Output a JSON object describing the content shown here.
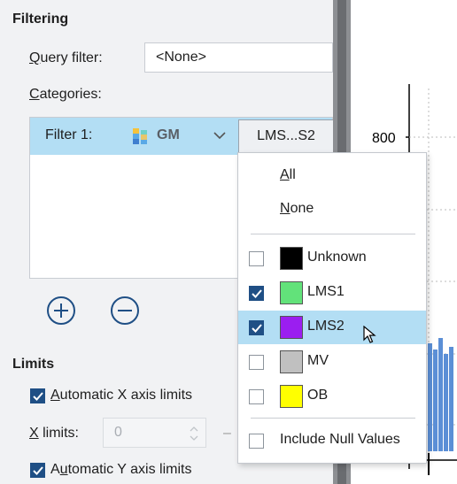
{
  "filtering": {
    "title": "Filtering",
    "query_filter_label": "Query filter:",
    "query_filter_value": "<None>",
    "categories_label": "Categories:",
    "filter_row": {
      "label": "Filter 1:",
      "attribute": "GM",
      "attribute_icon": "attribute-icon",
      "categories_button": "LMS...S2"
    },
    "add_icon": "plus-circle-icon",
    "remove_icon": "minus-circle-icon"
  },
  "limits": {
    "title": "Limits",
    "auto_x_label": "Automatic X axis limits",
    "auto_x_checked": true,
    "x_limits_label": "X limits:",
    "x_min_value": "0",
    "auto_y_label": "Automatic Y axis limits",
    "auto_y_checked": true
  },
  "chart": {
    "y_tick_label": "800",
    "bar_color": "#5b8fd6"
  },
  "dropdown": {
    "all_label": "All",
    "none_label": "None",
    "items": [
      {
        "label": "Unknown",
        "color": "#000000",
        "checked": false,
        "highlighted": false
      },
      {
        "label": "LMS1",
        "color": "#62e27a",
        "checked": true,
        "highlighted": false
      },
      {
        "label": "LMS2",
        "color": "#9b1ef0",
        "checked": true,
        "highlighted": true
      },
      {
        "label": "MV",
        "color": "#c0c0c0",
        "checked": false,
        "highlighted": false
      },
      {
        "label": "OB",
        "color": "#ffff00",
        "checked": false,
        "highlighted": false
      }
    ],
    "include_null_label": "Include Null Values",
    "include_null_checked": false
  },
  "colors": {
    "highlight": "#b3def4",
    "checkbox_checked": "#1f4f85",
    "panel_bg": "#f1f2f4"
  }
}
